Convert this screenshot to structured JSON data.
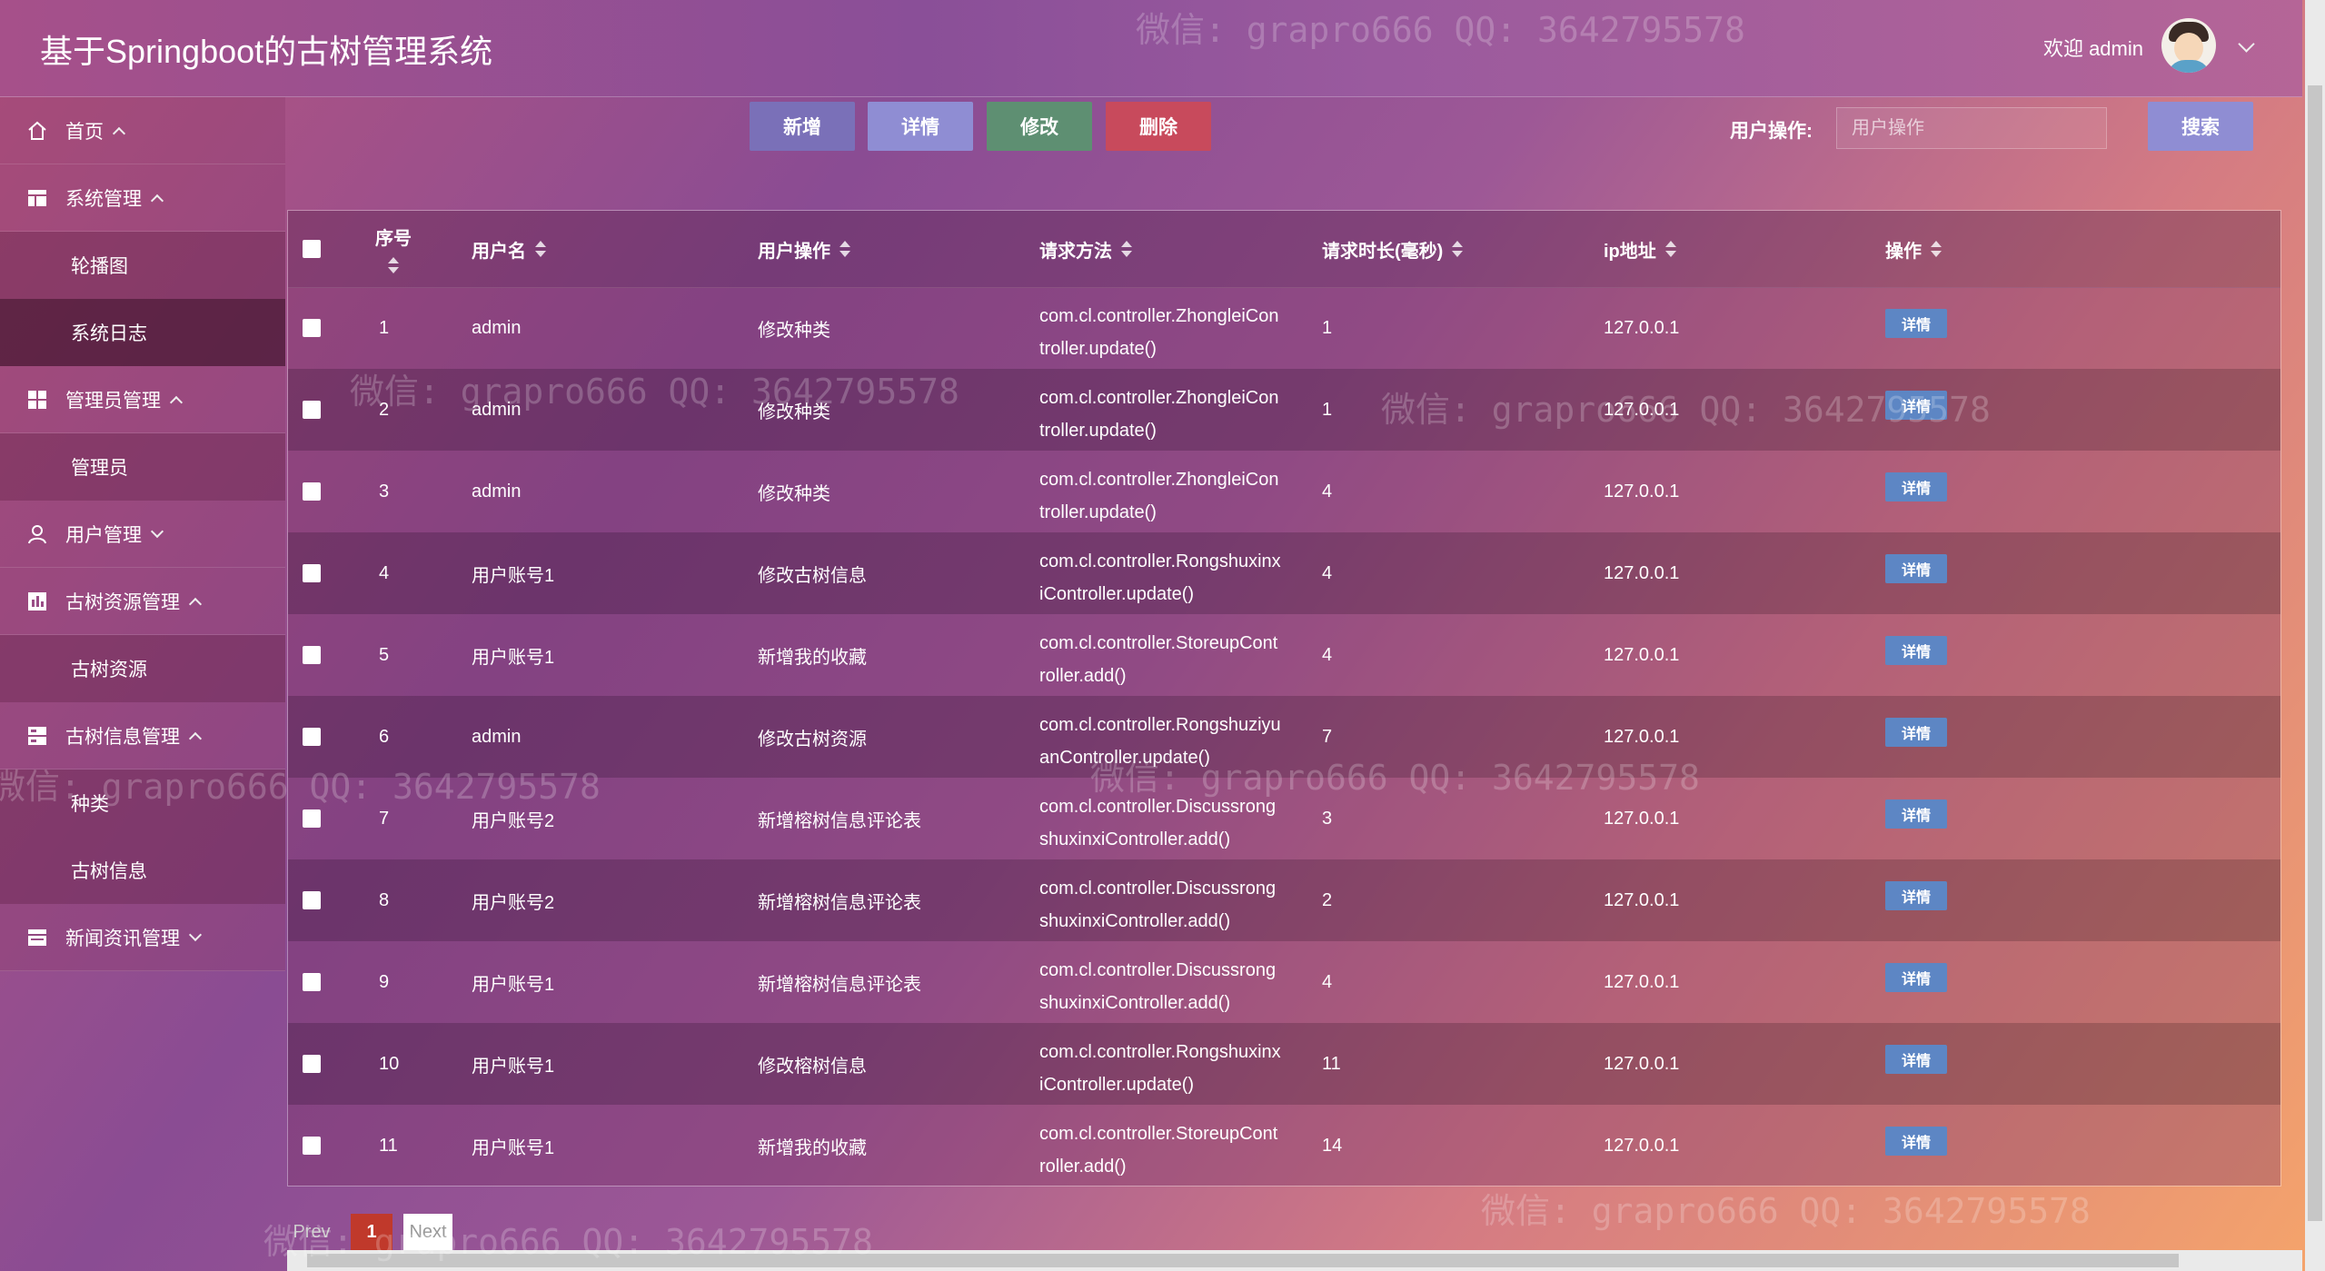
{
  "header": {
    "title": "基于Springboot的古树管理系统",
    "welcome": "欢迎 admin"
  },
  "sidebar": {
    "items": [
      {
        "label": "首页",
        "icon": "home-icon"
      },
      {
        "label": "系统管理",
        "icon": "table-icon"
      },
      {
        "label": "轮播图"
      },
      {
        "label": "系统日志"
      },
      {
        "label": "管理员管理",
        "icon": "grid-icon"
      },
      {
        "label": "管理员"
      },
      {
        "label": "用户管理",
        "icon": "user-icon"
      },
      {
        "label": "古树资源管理",
        "icon": "chart-icon"
      },
      {
        "label": "古树资源"
      },
      {
        "label": "古树信息管理",
        "icon": "list-icon"
      },
      {
        "label": "种类"
      },
      {
        "label": "古树信息"
      },
      {
        "label": "新闻资讯管理",
        "icon": "news-icon"
      }
    ]
  },
  "toolbar": {
    "add": "新增",
    "detail": "详情",
    "edit": "修改",
    "delete": "删除",
    "search_label": "用户操作:",
    "search_placeholder": "用户操作",
    "search_button": "搜索"
  },
  "table": {
    "headers": [
      "序号",
      "用户名",
      "用户操作",
      "请求方法",
      "请求时长(毫秒)",
      "ip地址",
      "操作"
    ],
    "op_label": "详情",
    "rows": [
      {
        "no": "1",
        "user": "admin",
        "op": "修改种类",
        "m1": "com.cl.controller.ZhongleiCon",
        "m2": "troller.update()",
        "dur": "1",
        "ip": "127.0.0.1"
      },
      {
        "no": "2",
        "user": "admin",
        "op": "修改种类",
        "m1": "com.cl.controller.ZhongleiCon",
        "m2": "troller.update()",
        "dur": "1",
        "ip": "127.0.0.1"
      },
      {
        "no": "3",
        "user": "admin",
        "op": "修改种类",
        "m1": "com.cl.controller.ZhongleiCon",
        "m2": "troller.update()",
        "dur": "4",
        "ip": "127.0.0.1"
      },
      {
        "no": "4",
        "user": "用户账号1",
        "op": "修改古树信息",
        "m1": "com.cl.controller.Rongshuxinx",
        "m2": "iController.update()",
        "dur": "4",
        "ip": "127.0.0.1"
      },
      {
        "no": "5",
        "user": "用户账号1",
        "op": "新增我的收藏",
        "m1": "com.cl.controller.StoreupCont",
        "m2": "roller.add()",
        "dur": "4",
        "ip": "127.0.0.1"
      },
      {
        "no": "6",
        "user": "admin",
        "op": "修改古树资源",
        "m1": "com.cl.controller.Rongshuziyu",
        "m2": "anController.update()",
        "dur": "7",
        "ip": "127.0.0.1"
      },
      {
        "no": "7",
        "user": "用户账号2",
        "op": "新增榕树信息评论表",
        "m1": "com.cl.controller.Discussrong",
        "m2": "shuxinxiController.add()",
        "dur": "3",
        "ip": "127.0.0.1"
      },
      {
        "no": "8",
        "user": "用户账号2",
        "op": "新增榕树信息评论表",
        "m1": "com.cl.controller.Discussrong",
        "m2": "shuxinxiController.add()",
        "dur": "2",
        "ip": "127.0.0.1"
      },
      {
        "no": "9",
        "user": "用户账号1",
        "op": "新增榕树信息评论表",
        "m1": "com.cl.controller.Discussrong",
        "m2": "shuxinxiController.add()",
        "dur": "4",
        "ip": "127.0.0.1"
      },
      {
        "no": "10",
        "user": "用户账号1",
        "op": "修改榕树信息",
        "m1": "com.cl.controller.Rongshuxinx",
        "m2": "iController.update()",
        "dur": "11",
        "ip": "127.0.0.1"
      },
      {
        "no": "11",
        "user": "用户账号1",
        "op": "新增我的收藏",
        "m1": "com.cl.controller.StoreupCont",
        "m2": "roller.add()",
        "dur": "14",
        "ip": "127.0.0.1"
      }
    ]
  },
  "pagination": {
    "prev": "Prev",
    "current": "1",
    "next": "Next"
  },
  "watermark": "微信: grapro666 QQ: 3642795578"
}
